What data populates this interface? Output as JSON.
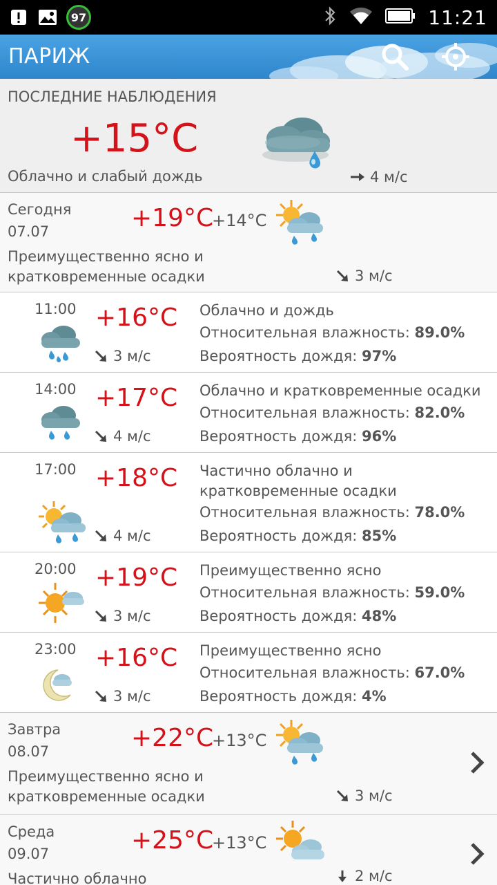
{
  "status_bar": {
    "battery_badge": "97",
    "time": "11:21"
  },
  "header": {
    "title": "ПАРИЖ"
  },
  "current": {
    "heading": "ПОСЛЕДНИЕ НАБЛЮДЕНИЯ",
    "temp": "+15°C",
    "description": "Облачно и слабый дождь",
    "wind": "4 м/с"
  },
  "days": [
    {
      "name": "Сегодня",
      "date": "07.07",
      "high": "+19°C",
      "low": "+14°C",
      "description": "Преимущественно ясно и кратковременные осадки",
      "wind": "3 м/с"
    },
    {
      "name": "Завтра",
      "date": "08.07",
      "high": "+22°C",
      "low": "+13°C",
      "description": "Преимущественно ясно и кратковременные осадки",
      "wind": "3 м/с"
    },
    {
      "name": "Среда",
      "date": "09.07",
      "high": "+25°C",
      "low": "+13°C",
      "description": "Частично облачно",
      "wind": "2 м/с"
    }
  ],
  "labels": {
    "humidity": "Относительная влажность:",
    "rain_chance": "Вероятность дождя:"
  },
  "hours": [
    {
      "time": "11:00",
      "temp": "+16°C",
      "wind": "3 м/с",
      "condition": "Облачно и дождь",
      "humidity": "89.0%",
      "rain": "97%"
    },
    {
      "time": "14:00",
      "temp": "+17°C",
      "wind": "4 м/с",
      "condition": "Облачно и кратковременные осадки",
      "humidity": "82.0%",
      "rain": "96%"
    },
    {
      "time": "17:00",
      "temp": "+18°C",
      "wind": "4 м/с",
      "condition": "Частично облачно и кратковременные осадки",
      "humidity": "78.0%",
      "rain": "85%"
    },
    {
      "time": "20:00",
      "temp": "+19°C",
      "wind": "3 м/с",
      "condition": "Преимущественно ясно",
      "humidity": "59.0%",
      "rain": "48%"
    },
    {
      "time": "23:00",
      "temp": "+16°C",
      "wind": "3 м/с",
      "condition": "Преимущественно ясно",
      "humidity": "67.0%",
      "rain": "4%"
    }
  ],
  "icons": {
    "status_left": [
      "notification-alert-icon",
      "gallery-icon",
      "battery-saver-badge"
    ],
    "status_right": [
      "bluetooth-icon",
      "wifi-icon",
      "battery-icon"
    ],
    "header": [
      "search-icon",
      "locate-icon"
    ]
  },
  "colors": {
    "temperature": "#d4121a",
    "header": "#2f86cc",
    "divider": "#c8c8c8"
  }
}
